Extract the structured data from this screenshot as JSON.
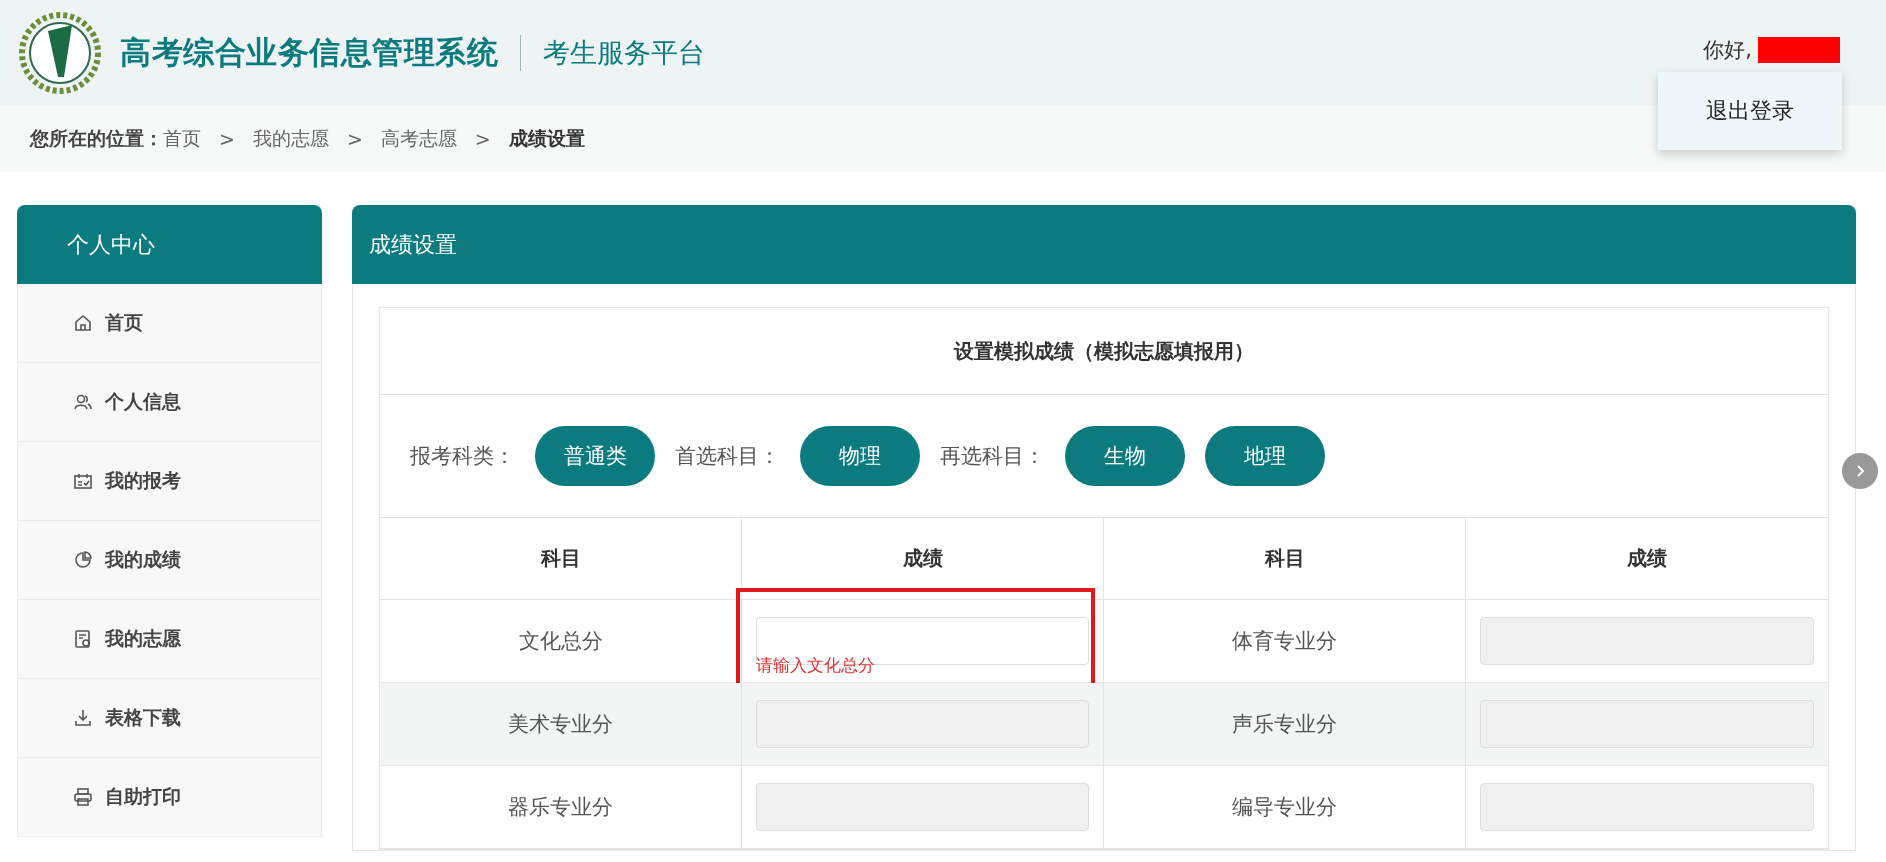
{
  "header": {
    "title": "高考综合业务信息管理系统",
    "subtitle": "考生服务平台",
    "greeting": "你好,",
    "logout": "退出登录"
  },
  "breadcrumb": {
    "label": "您所在的位置：",
    "items": [
      {
        "text": "首页",
        "current": false
      },
      {
        "text": "我的志愿",
        "current": false
      },
      {
        "text": "高考志愿",
        "current": false
      },
      {
        "text": "成绩设置",
        "current": true
      }
    ],
    "separator": ">"
  },
  "sidebar": {
    "title": "个人中心",
    "items": [
      {
        "label": "首页"
      },
      {
        "label": "个人信息"
      },
      {
        "label": "我的报考"
      },
      {
        "label": "我的成绩"
      },
      {
        "label": "我的志愿"
      },
      {
        "label": "表格下载"
      },
      {
        "label": "自助打印"
      }
    ]
  },
  "panel": {
    "title": "成绩设置",
    "card_title": "设置模拟成绩（模拟志愿填报用）",
    "choices": [
      {
        "label": "报考科类：",
        "chips": [
          "普通类"
        ]
      },
      {
        "label": "首选科目：",
        "chips": [
          "物理"
        ]
      },
      {
        "label": "再选科目：",
        "chips": [
          "生物",
          "地理"
        ]
      }
    ],
    "columns": [
      "科目",
      "成绩",
      "科目",
      "成绩"
    ],
    "rows": [
      [
        {
          "subject": "文化总分",
          "disabled": false,
          "error": "请输入文化总分",
          "highlighted": true
        },
        {
          "subject": "体育专业分",
          "disabled": true
        }
      ],
      [
        {
          "subject": "美术专业分",
          "disabled": true
        },
        {
          "subject": "声乐专业分",
          "disabled": true
        }
      ],
      [
        {
          "subject": "器乐专业分",
          "disabled": true
        },
        {
          "subject": "编导专业分",
          "disabled": true
        }
      ]
    ]
  }
}
